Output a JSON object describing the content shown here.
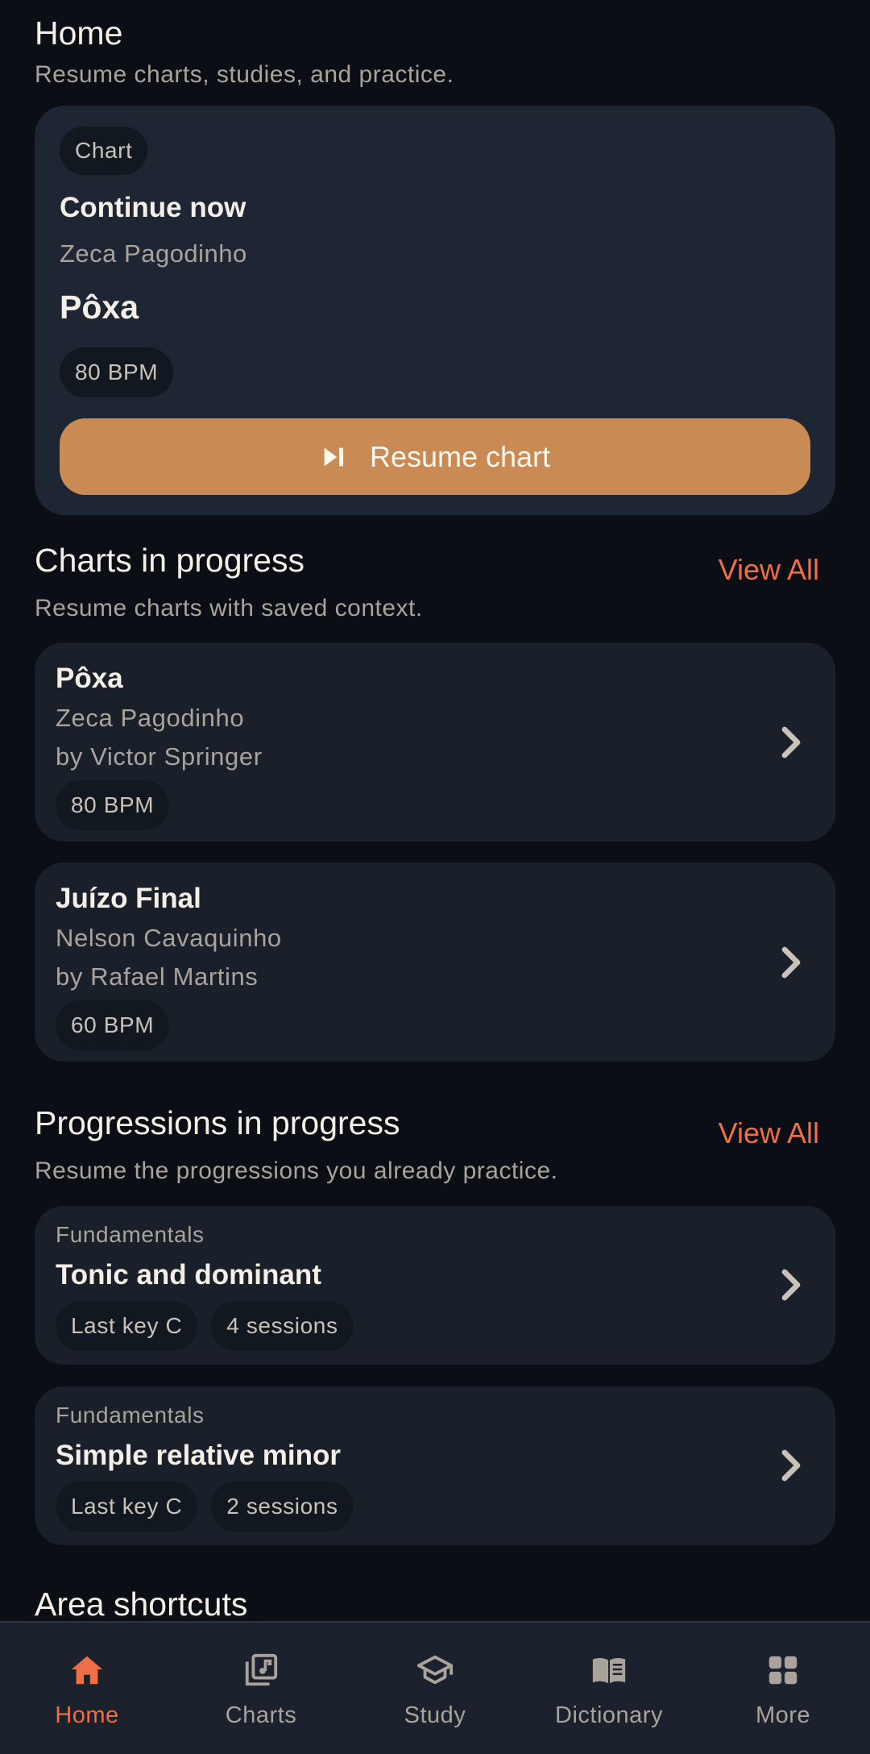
{
  "header": {
    "title": "Home",
    "subtitle": "Resume charts, studies, and practice."
  },
  "hero": {
    "type_chip": "Chart",
    "label": "Continue now",
    "artist": "Zeca Pagodinho",
    "song": "Pôxa",
    "bpm": "80 BPM",
    "button_label": "Resume chart",
    "button_icon": "skip-next-icon"
  },
  "charts_section": {
    "title": "Charts in progress",
    "subtitle": "Resume charts with saved context.",
    "view_all": "View All",
    "items": [
      {
        "title": "Pôxa",
        "artist": "Zeca Pagodinho",
        "author": "by Victor Springer",
        "bpm": "80 BPM"
      },
      {
        "title": "Juízo Final",
        "artist": "Nelson Cavaquinho",
        "author": "by Rafael Martins",
        "bpm": "60 BPM"
      }
    ]
  },
  "progressions_section": {
    "title": "Progressions in progress",
    "subtitle": "Resume the progressions you already practice.",
    "view_all": "View All",
    "items": [
      {
        "category": "Fundamentals",
        "title": "Tonic and dominant",
        "key": "Last key C",
        "sessions": "4 sessions"
      },
      {
        "category": "Fundamentals",
        "title": "Simple relative minor",
        "key": "Last key C",
        "sessions": "2 sessions"
      }
    ]
  },
  "shortcuts_section": {
    "title": "Area shortcuts"
  },
  "bottom_nav": {
    "items": [
      {
        "label": "Home",
        "icon": "home-icon",
        "active": true
      },
      {
        "label": "Charts",
        "icon": "music-library-icon",
        "active": false
      },
      {
        "label": "Study",
        "icon": "school-icon",
        "active": false
      },
      {
        "label": "Dictionary",
        "icon": "open-book-icon",
        "active": false
      },
      {
        "label": "More",
        "icon": "grid-icon",
        "active": false
      }
    ]
  },
  "colors": {
    "background": "#0b0f15",
    "card": "#19202a",
    "hero_card": "#1d2632",
    "accent": "#ee6e45",
    "resume_button": "#c98a54",
    "muted_text": "#a9a39b"
  }
}
